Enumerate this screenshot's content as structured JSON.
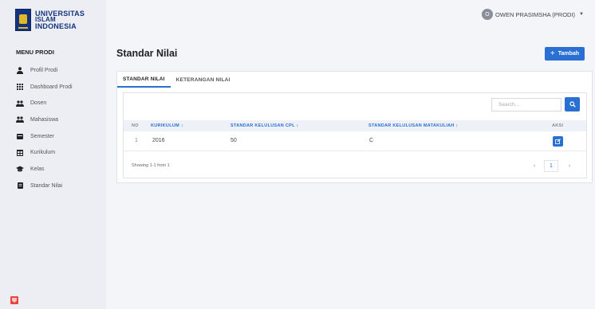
{
  "brand": {
    "line1": "UNIVERSITAS",
    "line2": "ISLAM",
    "line3": "INDONESIA"
  },
  "user": {
    "avatar_initial": "O",
    "name": "OWEN PRASIMSHA (PRODI)"
  },
  "sidebar": {
    "title": "MENU PRODI",
    "items": [
      {
        "label": "Profil Prodi",
        "icon": "user-icon"
      },
      {
        "label": "Dashboard Prodi",
        "icon": "grid-icon"
      },
      {
        "label": "Dosen",
        "icon": "users-icon"
      },
      {
        "label": "Mahasiswa",
        "icon": "users-icon"
      },
      {
        "label": "Semester",
        "icon": "calendar-icon"
      },
      {
        "label": "Kurikulum",
        "icon": "table-icon"
      },
      {
        "label": "Kelas",
        "icon": "graduation-cap-icon"
      },
      {
        "label": "Standar Nilai",
        "icon": "document-icon"
      }
    ]
  },
  "page": {
    "title": "Standar Nilai",
    "add_label": "Tambah"
  },
  "tabs": [
    {
      "label": "STANDAR NILAI",
      "active": true
    },
    {
      "label": "KETERANGAN NILAI",
      "active": false
    }
  ],
  "search": {
    "placeholder": "Search..."
  },
  "table": {
    "headers": {
      "no": "NO",
      "kurikulum": "KURIKULUM ↕",
      "cpl": "STANDAR KELULUSAN CPL ↕",
      "matakuliah": "STANDAR KELULUSAN MATAKULIAH ↕",
      "aksi": "AKSI"
    },
    "rows": [
      {
        "no": "1",
        "kurikulum": "2016",
        "cpl": "50",
        "matakuliah": "C"
      }
    ],
    "showing": "Showing 1-1 from 1",
    "page": "1"
  },
  "colors": {
    "primary": "#2a6fd2",
    "brand": "#14337f",
    "sidebar_bg": "#eceef4"
  }
}
